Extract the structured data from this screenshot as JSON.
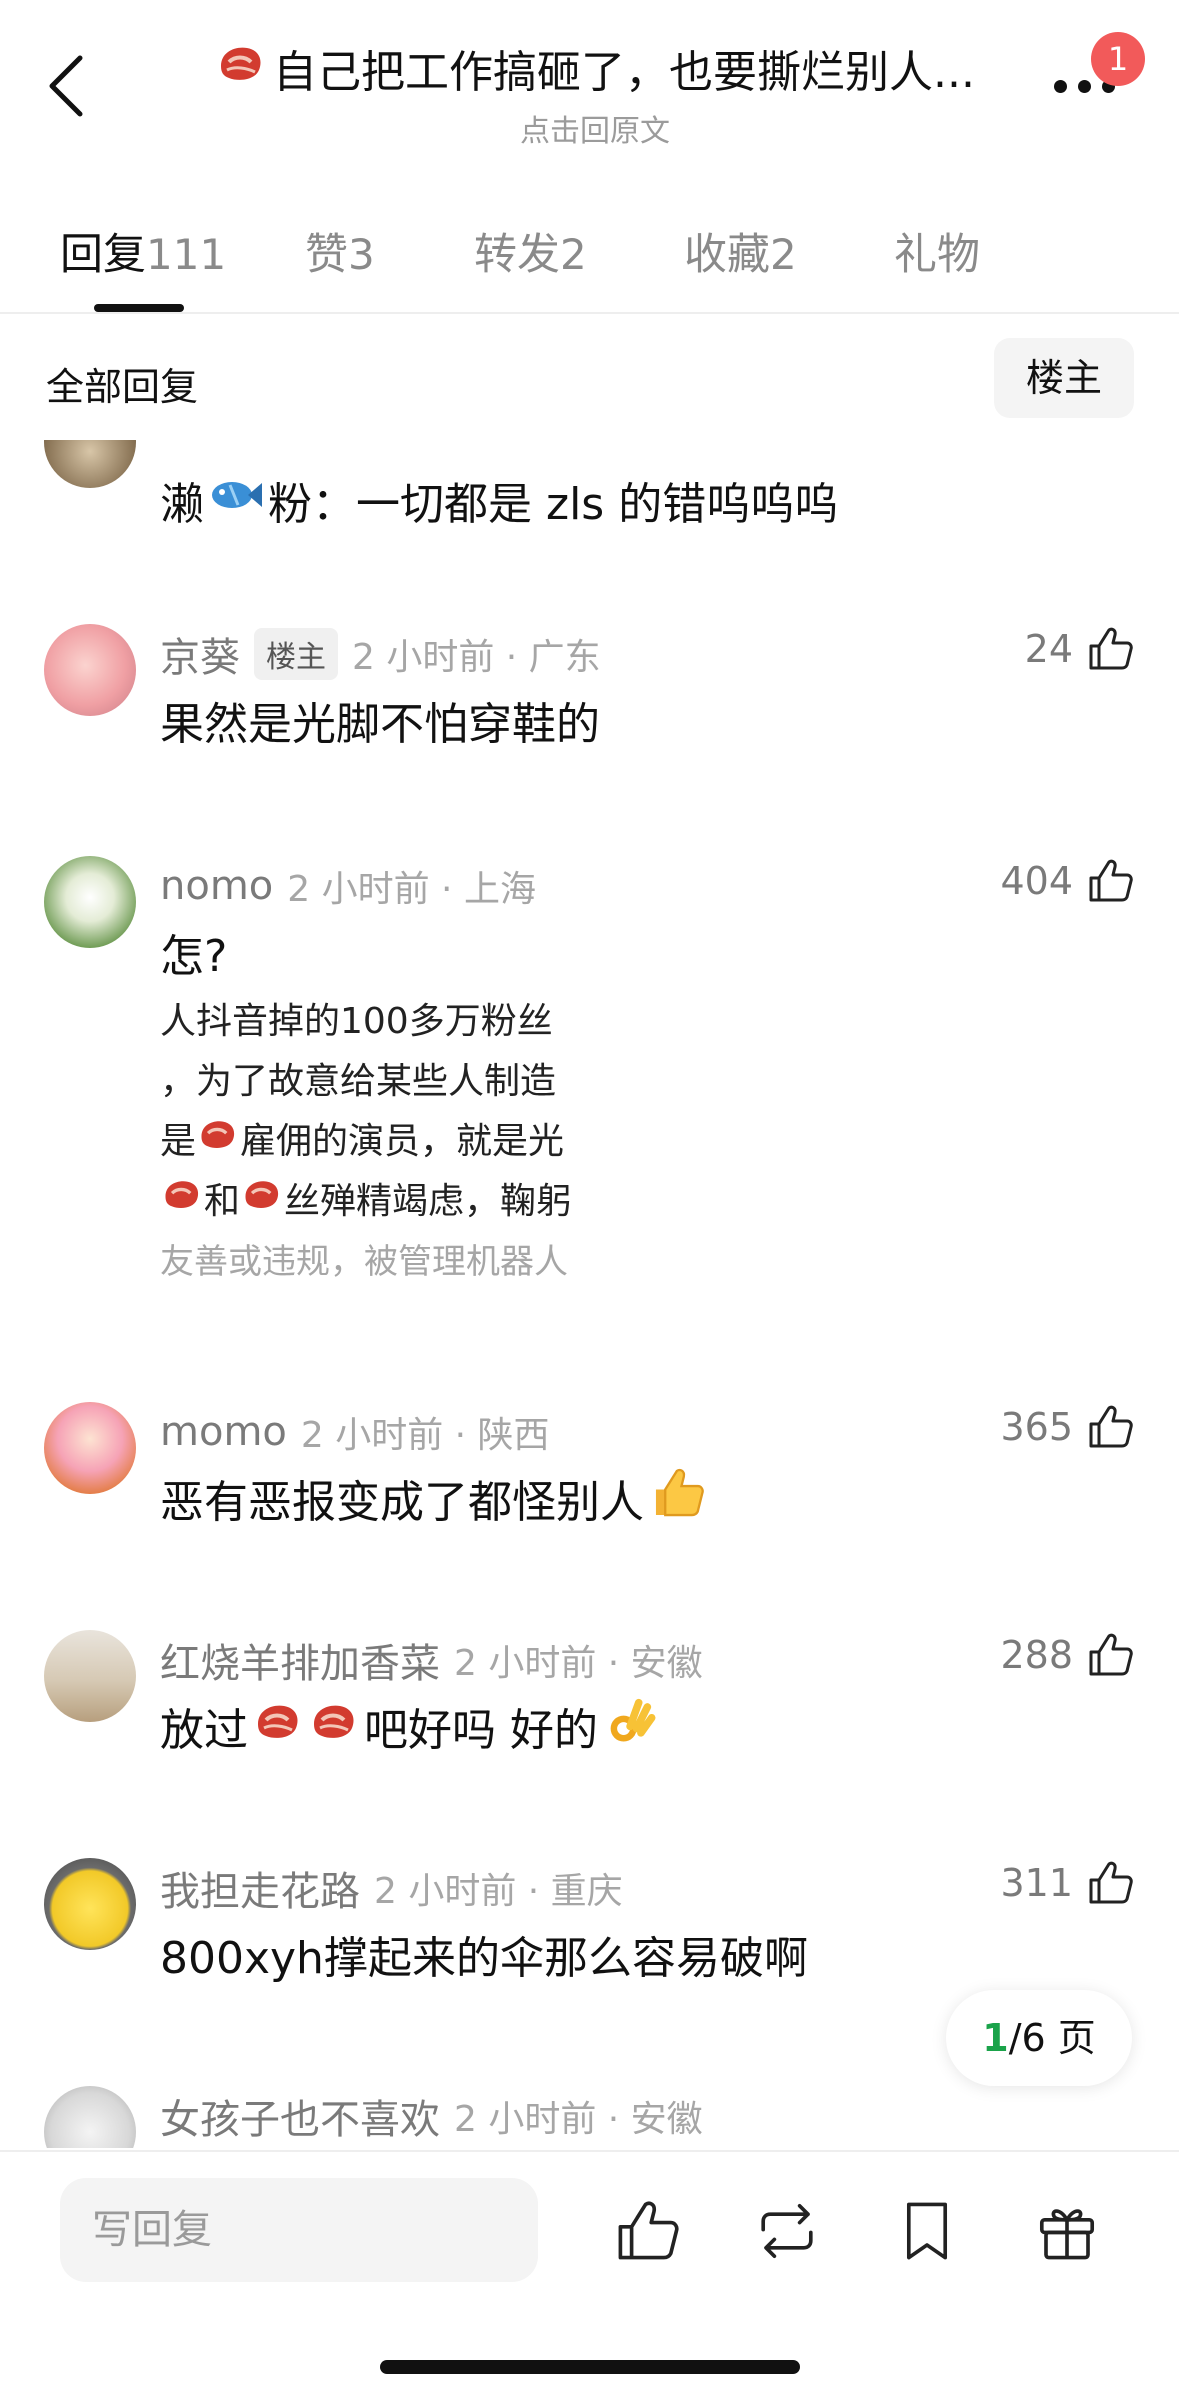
{
  "header": {
    "title": "自己把工作搞砸了，也要撕烂别人...",
    "subtitle": "点击回原文",
    "notification_count": "1"
  },
  "tabs": [
    {
      "label": "回复",
      "count": "111"
    },
    {
      "label": "赞",
      "count": "3"
    },
    {
      "label": "转发",
      "count": "2"
    },
    {
      "label": "收藏",
      "count": "2"
    },
    {
      "label": "礼物",
      "count": ""
    }
  ],
  "filter": {
    "label": "全部回复",
    "owner_button": "楼主"
  },
  "comments": [
    {
      "content_a": "濑",
      "content_b": "粉：一切都是 zls 的错呜呜呜"
    },
    {
      "username": "京葵",
      "tag": "楼主",
      "time": "2 小时前 · 广东",
      "likes": "24",
      "content": "果然是光脚不怕穿鞋的"
    },
    {
      "username": "nomo",
      "time": "2 小时前 · 上海",
      "likes": "404",
      "content": "怎?",
      "quote": [
        "人抖音掉的100多万粉丝",
        "，为了故意给某些人制造",
        "是",
        "和",
        "友善或违规，被管理机器人"
      ],
      "quote_parts": {
        "line3_after": "雇佣的演员，就是光",
        "line4_after": "丝殚精竭虑，鞠躬"
      }
    },
    {
      "username": "momo",
      "time": "2 小时前 · 陕西",
      "likes": "365",
      "content": "恶有恶报变成了都怪别人"
    },
    {
      "username": "红烧羊排加香菜",
      "time": "2 小时前 · 安徽",
      "likes": "288",
      "content_a": "放过",
      "content_b": "吧好吗 好的"
    },
    {
      "username": "我担走花路",
      "time": "2 小时前 · 重庆",
      "likes": "311",
      "content": "800xyh撑起来的伞那么容易破啊"
    },
    {
      "username": "女孩子也不喜欢",
      "time": "2 小时前 · 安徽"
    }
  ],
  "pager": {
    "current": "1",
    "total": "/6 页"
  },
  "bottom": {
    "reply_placeholder": "写回复"
  },
  "colors": {
    "accent_green": "#1aa34a",
    "badge_red": "#f25a5a",
    "muted_text": "#7a7a7a"
  }
}
